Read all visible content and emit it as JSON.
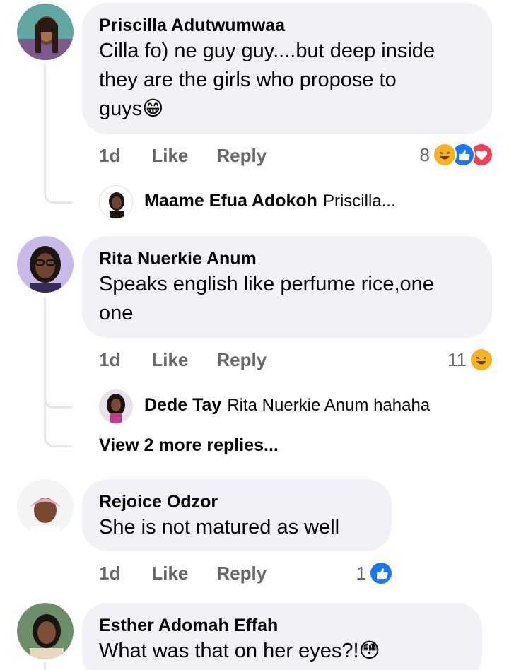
{
  "comments": [
    {
      "author": "Priscilla Adutwumwaa",
      "lines": [
        "Cilla fo) ne guy guy....but deep inside",
        "they are the girls who propose to",
        "guys😁"
      ],
      "age": "1d",
      "like": "Like",
      "reply": "Reply",
      "reaction_count": "8",
      "reactions": [
        "haha",
        "like",
        "love"
      ],
      "replies": [
        {
          "name": "Maame Efua Adokoh",
          "text": "Priscilla..."
        }
      ]
    },
    {
      "author": "Rita Nuerkie Anum",
      "lines": [
        "Speaks english like perfume rice,one",
        "one"
      ],
      "age": "1d",
      "like": "Like",
      "reply": "Reply",
      "reaction_count": "11",
      "reactions": [
        "haha"
      ],
      "replies": [
        {
          "name": "Dede Tay",
          "text": "Rita Nuerkie Anum hahaha"
        }
      ],
      "view_more": "View 2 more replies..."
    },
    {
      "author": "Rejoice Odzor",
      "lines": [
        "She is not matured as well"
      ],
      "age": "1d",
      "like": "Like",
      "reply": "Reply",
      "reaction_count": "1",
      "reactions": [
        "like"
      ]
    },
    {
      "author": "Esther Adomah Effah",
      "lines": [
        "What was that on her eyes?!😳"
      ]
    }
  ],
  "colors": {
    "bubble": "#f0f2f5",
    "meta_text": "#65676b",
    "like_blue": "#1877f2",
    "love_red": "#f33e58",
    "haha_yellow": "#f7b125"
  }
}
